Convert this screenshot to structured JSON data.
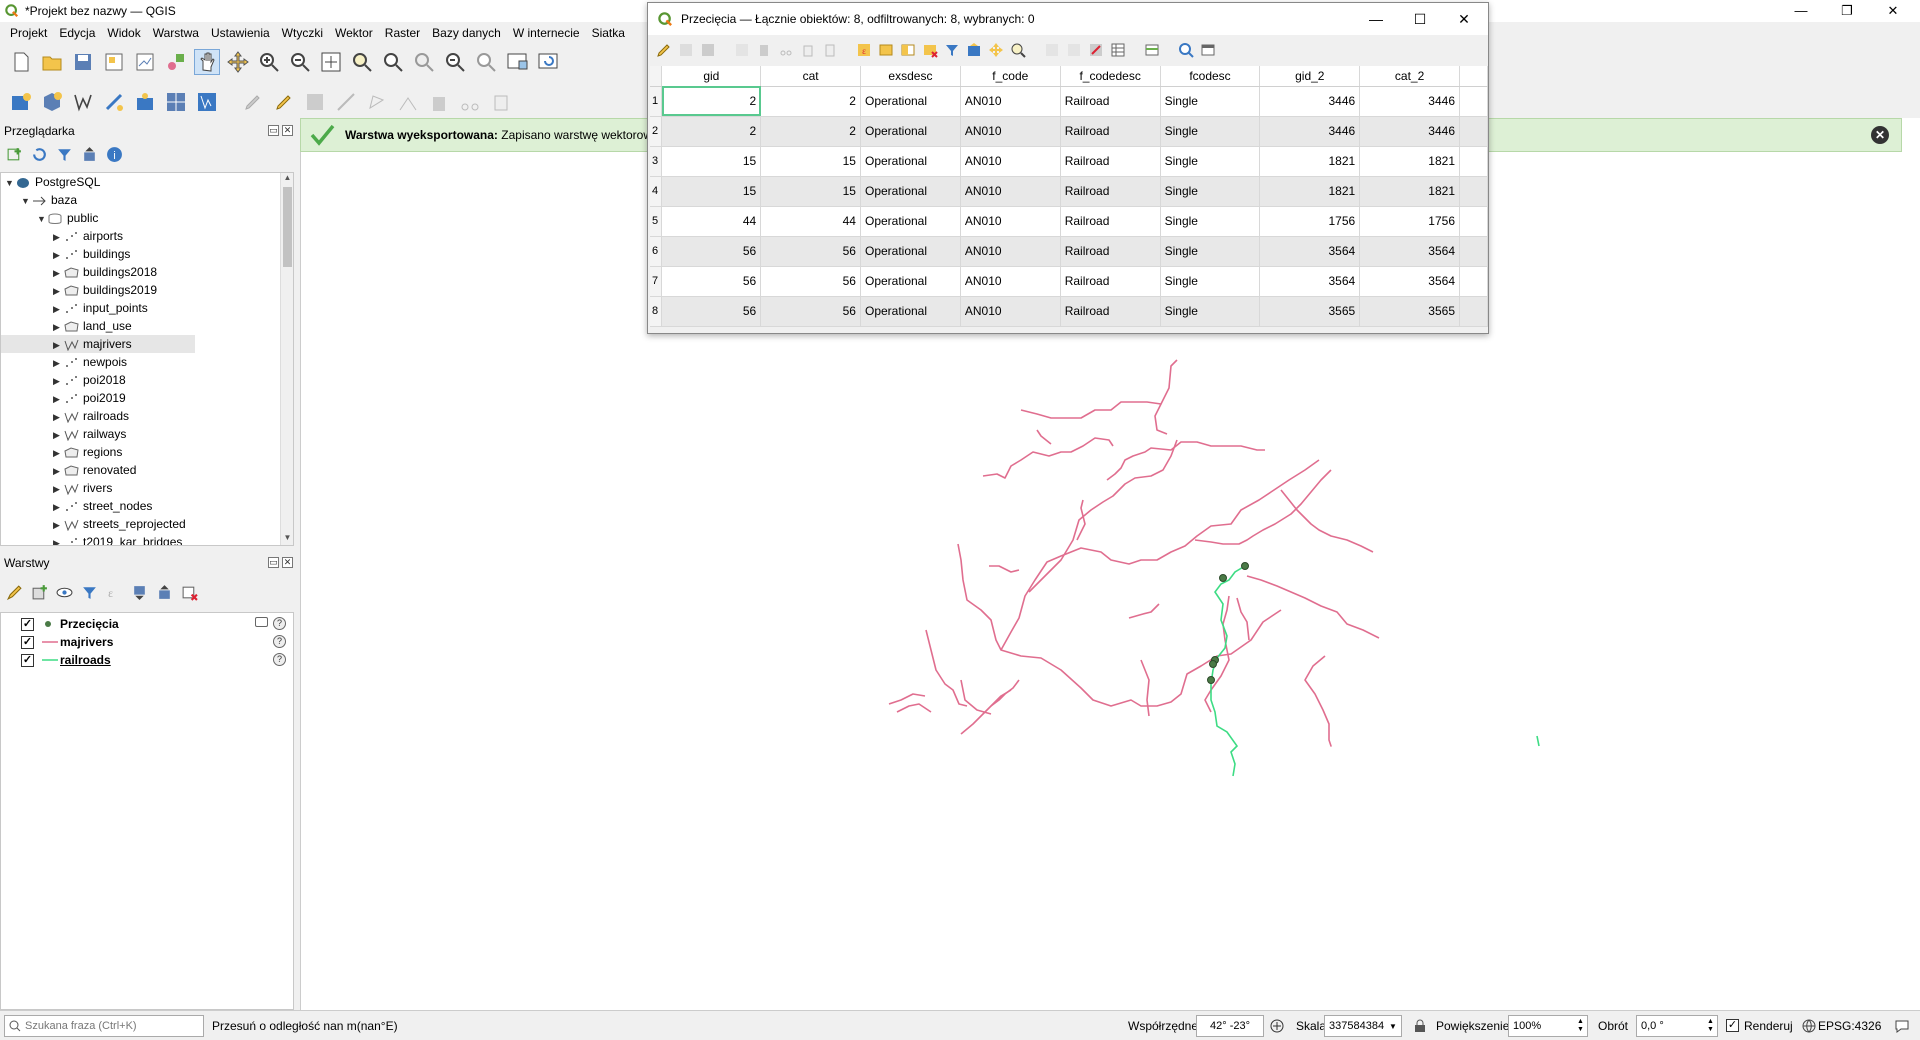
{
  "window": {
    "title": "*Projekt bez nazwy — QGIS"
  },
  "menu": [
    "Projekt",
    "Edycja",
    "Widok",
    "Warstwa",
    "Ustawienia",
    "Wtyczki",
    "Wektor",
    "Raster",
    "Bazy danych",
    "W internecie",
    "Siatka"
  ],
  "browser": {
    "title": "Przeglądarka",
    "items": [
      {
        "label": "PostgreSQL",
        "level": 0,
        "icon": "postgres-icon",
        "expanded": true
      },
      {
        "label": "baza",
        "level": 1,
        "icon": "connection-icon",
        "expanded": true
      },
      {
        "label": "public",
        "level": 2,
        "icon": "schema-icon",
        "expanded": true
      },
      {
        "label": "airports",
        "level": 3,
        "icon": "point-layer-icon"
      },
      {
        "label": "buildings",
        "level": 3,
        "icon": "point-layer-icon"
      },
      {
        "label": "buildings2018",
        "level": 3,
        "icon": "polygon-layer-icon"
      },
      {
        "label": "buildings2019",
        "level": 3,
        "icon": "polygon-layer-icon"
      },
      {
        "label": "input_points",
        "level": 3,
        "icon": "point-layer-icon"
      },
      {
        "label": "land_use",
        "level": 3,
        "icon": "polygon-layer-icon"
      },
      {
        "label": "majrivers",
        "level": 3,
        "icon": "line-layer-icon",
        "highlight": true
      },
      {
        "label": "newpois",
        "level": 3,
        "icon": "point-layer-icon"
      },
      {
        "label": "poi2018",
        "level": 3,
        "icon": "point-layer-icon"
      },
      {
        "label": "poi2019",
        "level": 3,
        "icon": "point-layer-icon"
      },
      {
        "label": "railroads",
        "level": 3,
        "icon": "line-layer-icon"
      },
      {
        "label": "railways",
        "level": 3,
        "icon": "line-layer-icon"
      },
      {
        "label": "regions",
        "level": 3,
        "icon": "polygon-layer-icon"
      },
      {
        "label": "renovated",
        "level": 3,
        "icon": "polygon-layer-icon"
      },
      {
        "label": "rivers",
        "level": 3,
        "icon": "line-layer-icon"
      },
      {
        "label": "street_nodes",
        "level": 3,
        "icon": "point-layer-icon"
      },
      {
        "label": "streets_reprojected",
        "level": 3,
        "icon": "line-layer-icon"
      },
      {
        "label": "t2019_kar_bridges",
        "level": 3,
        "icon": "point-layer-icon"
      }
    ]
  },
  "layers": {
    "title": "Warstwy",
    "items": [
      {
        "label": "Przecięcia",
        "symbol": "point",
        "color": "#4a7a46",
        "checked": true
      },
      {
        "label": "majrivers",
        "symbol": "line",
        "color": "#e06e8f",
        "checked": true
      },
      {
        "label": "railroads",
        "symbol": "line",
        "color": "#3ddc84",
        "checked": true,
        "underline": true
      }
    ]
  },
  "message": {
    "bold": "Warstwa wyeksportowana:",
    "text": "Zapisano warstwę wektorową"
  },
  "attribute_table": {
    "title": "Przecięcia — Łącznie obiektów: 8, odfiltrowanych: 8, wybranych: 0",
    "columns": [
      "gid",
      "cat",
      "exsdesc",
      "f_code",
      "f_codedesc",
      "fcodesc",
      "gid_2",
      "cat_2"
    ],
    "rows": [
      [
        "1",
        "2",
        "2",
        "Operational",
        "AN010",
        "Railroad",
        "Single",
        "3446",
        "3446"
      ],
      [
        "2",
        "2",
        "2",
        "Operational",
        "AN010",
        "Railroad",
        "Single",
        "3446",
        "3446"
      ],
      [
        "3",
        "15",
        "15",
        "Operational",
        "AN010",
        "Railroad",
        "Single",
        "1821",
        "1821"
      ],
      [
        "4",
        "15",
        "15",
        "Operational",
        "AN010",
        "Railroad",
        "Single",
        "1821",
        "1821"
      ],
      [
        "5",
        "44",
        "44",
        "Operational",
        "AN010",
        "Railroad",
        "Single",
        "1756",
        "1756"
      ],
      [
        "6",
        "56",
        "56",
        "Operational",
        "AN010",
        "Railroad",
        "Single",
        "3564",
        "3564"
      ],
      [
        "7",
        "56",
        "56",
        "Operational",
        "AN010",
        "Railroad",
        "Single",
        "3564",
        "3564"
      ],
      [
        "8",
        "56",
        "56",
        "Operational",
        "AN010",
        "Railroad",
        "Single",
        "3565",
        "3565"
      ]
    ]
  },
  "status": {
    "search_placeholder": "Szukana fraza (Ctrl+K)",
    "hint": "Przesuń o odległość nan m(nan°E)",
    "coord_label": "Współrzędne",
    "coord_value": "42° -23°",
    "scale_label": "Skala",
    "scale_value": "337584384",
    "zoom_label": "Powiększenie",
    "zoom_value": "100%",
    "rotation_label": "Obrót",
    "rotation_value": "0,0 °",
    "render_label": "Renderuj",
    "crs": "EPSG:4326"
  },
  "colors": {
    "rivers": "#e06e8f",
    "railroads": "#3ddc84",
    "intersections": "#4a7a46",
    "message_bg": "#ddf0d5"
  }
}
